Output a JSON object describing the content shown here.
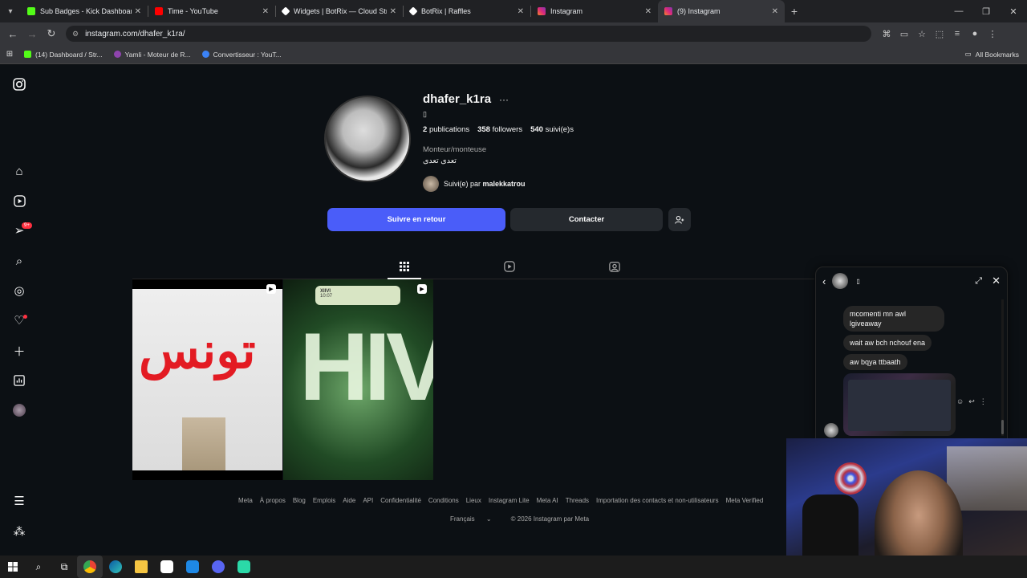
{
  "browser": {
    "tabs": [
      {
        "title": "Sub Badges - Kick Dashboard",
        "color": "#53fc18"
      },
      {
        "title": "Time - YouTube",
        "color": "#ff0000"
      },
      {
        "title": "Widgets | BotRix — Cloud Strea",
        "color": "#ffffff"
      },
      {
        "title": "BotRix | Raffles",
        "color": "#ffffff"
      },
      {
        "title": "Instagram",
        "color": "#e1306c"
      },
      {
        "title": "(9) Instagram",
        "color": "#e1306c"
      }
    ],
    "url": "instagram.com/dhafer_k1ra/",
    "bookmarks": [
      {
        "title": "(14) Dashboard / Str...",
        "color": "#53fc18"
      },
      {
        "title": "Yamli - Moteur de R...",
        "color": "#8e44ad"
      },
      {
        "title": "Convertisseur : YouT...",
        "color": "#3b82f6"
      }
    ],
    "all_bookmarks": "All Bookmarks"
  },
  "profile": {
    "username": "dhafer_k1ra",
    "glyph": "▯",
    "stats": {
      "posts_count": "2",
      "posts_label": "publications",
      "followers_count": "358",
      "followers_label": "followers",
      "following_count": "540",
      "following_label": "suivi(e)s"
    },
    "category": "Monteur/monteuse",
    "bio": "تعدى تعدى",
    "followed_by_prefix": "Suivi(e) par",
    "followed_by_user": "malekkatrou",
    "follow_back_label": "Suivre en retour",
    "contact_label": "Contacter"
  },
  "posts": [
    {
      "text": "تونس"
    },
    {
      "text": "HIV",
      "pill_title": "XIIVI",
      "pill_sub": "10:07"
    }
  ],
  "footer": {
    "links": [
      "Meta",
      "À propos",
      "Blog",
      "Emplois",
      "Aide",
      "API",
      "Confidentialité",
      "Conditions",
      "Lieux",
      "Instagram Lite",
      "Meta AI",
      "Threads",
      "Importation des contacts et non-utilisateurs",
      "Meta Verified"
    ],
    "language": "Français",
    "copyright": "© 2026 Instagram par Meta"
  },
  "chat": {
    "glyph": "▯",
    "messages": [
      "mcomenti mn awl lgiveaway",
      "wait aw bch nchouf ena",
      "aw bqya ttbaath"
    ]
  },
  "accent": "#4a5df9"
}
